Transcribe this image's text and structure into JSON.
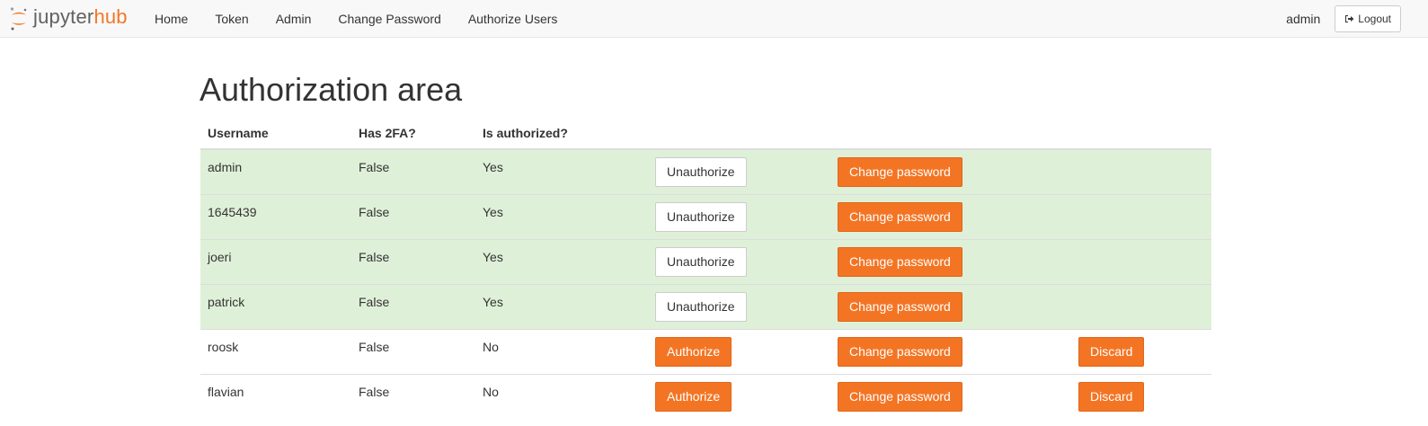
{
  "navbar": {
    "brand": {
      "part1": "jupyter",
      "part2": "hub"
    },
    "links": [
      "Home",
      "Token",
      "Admin",
      "Change Password",
      "Authorize Users"
    ],
    "user": "admin",
    "logout_label": "Logout"
  },
  "page": {
    "title": "Authorization area",
    "columns": [
      "Username",
      "Has 2FA?",
      "Is authorized?"
    ],
    "users": [
      {
        "username": "admin",
        "has_2fa": "False",
        "is_authorized": "Yes",
        "toggle_label": "Unauthorize",
        "change_label": "Change password"
      },
      {
        "username": "1645439",
        "has_2fa": "False",
        "is_authorized": "Yes",
        "toggle_label": "Unauthorize",
        "change_label": "Change password"
      },
      {
        "username": "joeri",
        "has_2fa": "False",
        "is_authorized": "Yes",
        "toggle_label": "Unauthorize",
        "change_label": "Change password"
      },
      {
        "username": "patrick",
        "has_2fa": "False",
        "is_authorized": "Yes",
        "toggle_label": "Unauthorize",
        "change_label": "Change password"
      },
      {
        "username": "roosk",
        "has_2fa": "False",
        "is_authorized": "No",
        "toggle_label": "Authorize",
        "change_label": "Change password",
        "discard_label": "Discard"
      },
      {
        "username": "flavian",
        "has_2fa": "False",
        "is_authorized": "No",
        "toggle_label": "Authorize",
        "change_label": "Change password",
        "discard_label": "Discard"
      }
    ]
  },
  "colors": {
    "accent": "#f37524",
    "authorized_row": "#dff0d8",
    "navbar_bg": "#f8f8f8"
  },
  "icons": {
    "brand": "jupyter-logo-icon",
    "logout": "sign-out-icon"
  }
}
